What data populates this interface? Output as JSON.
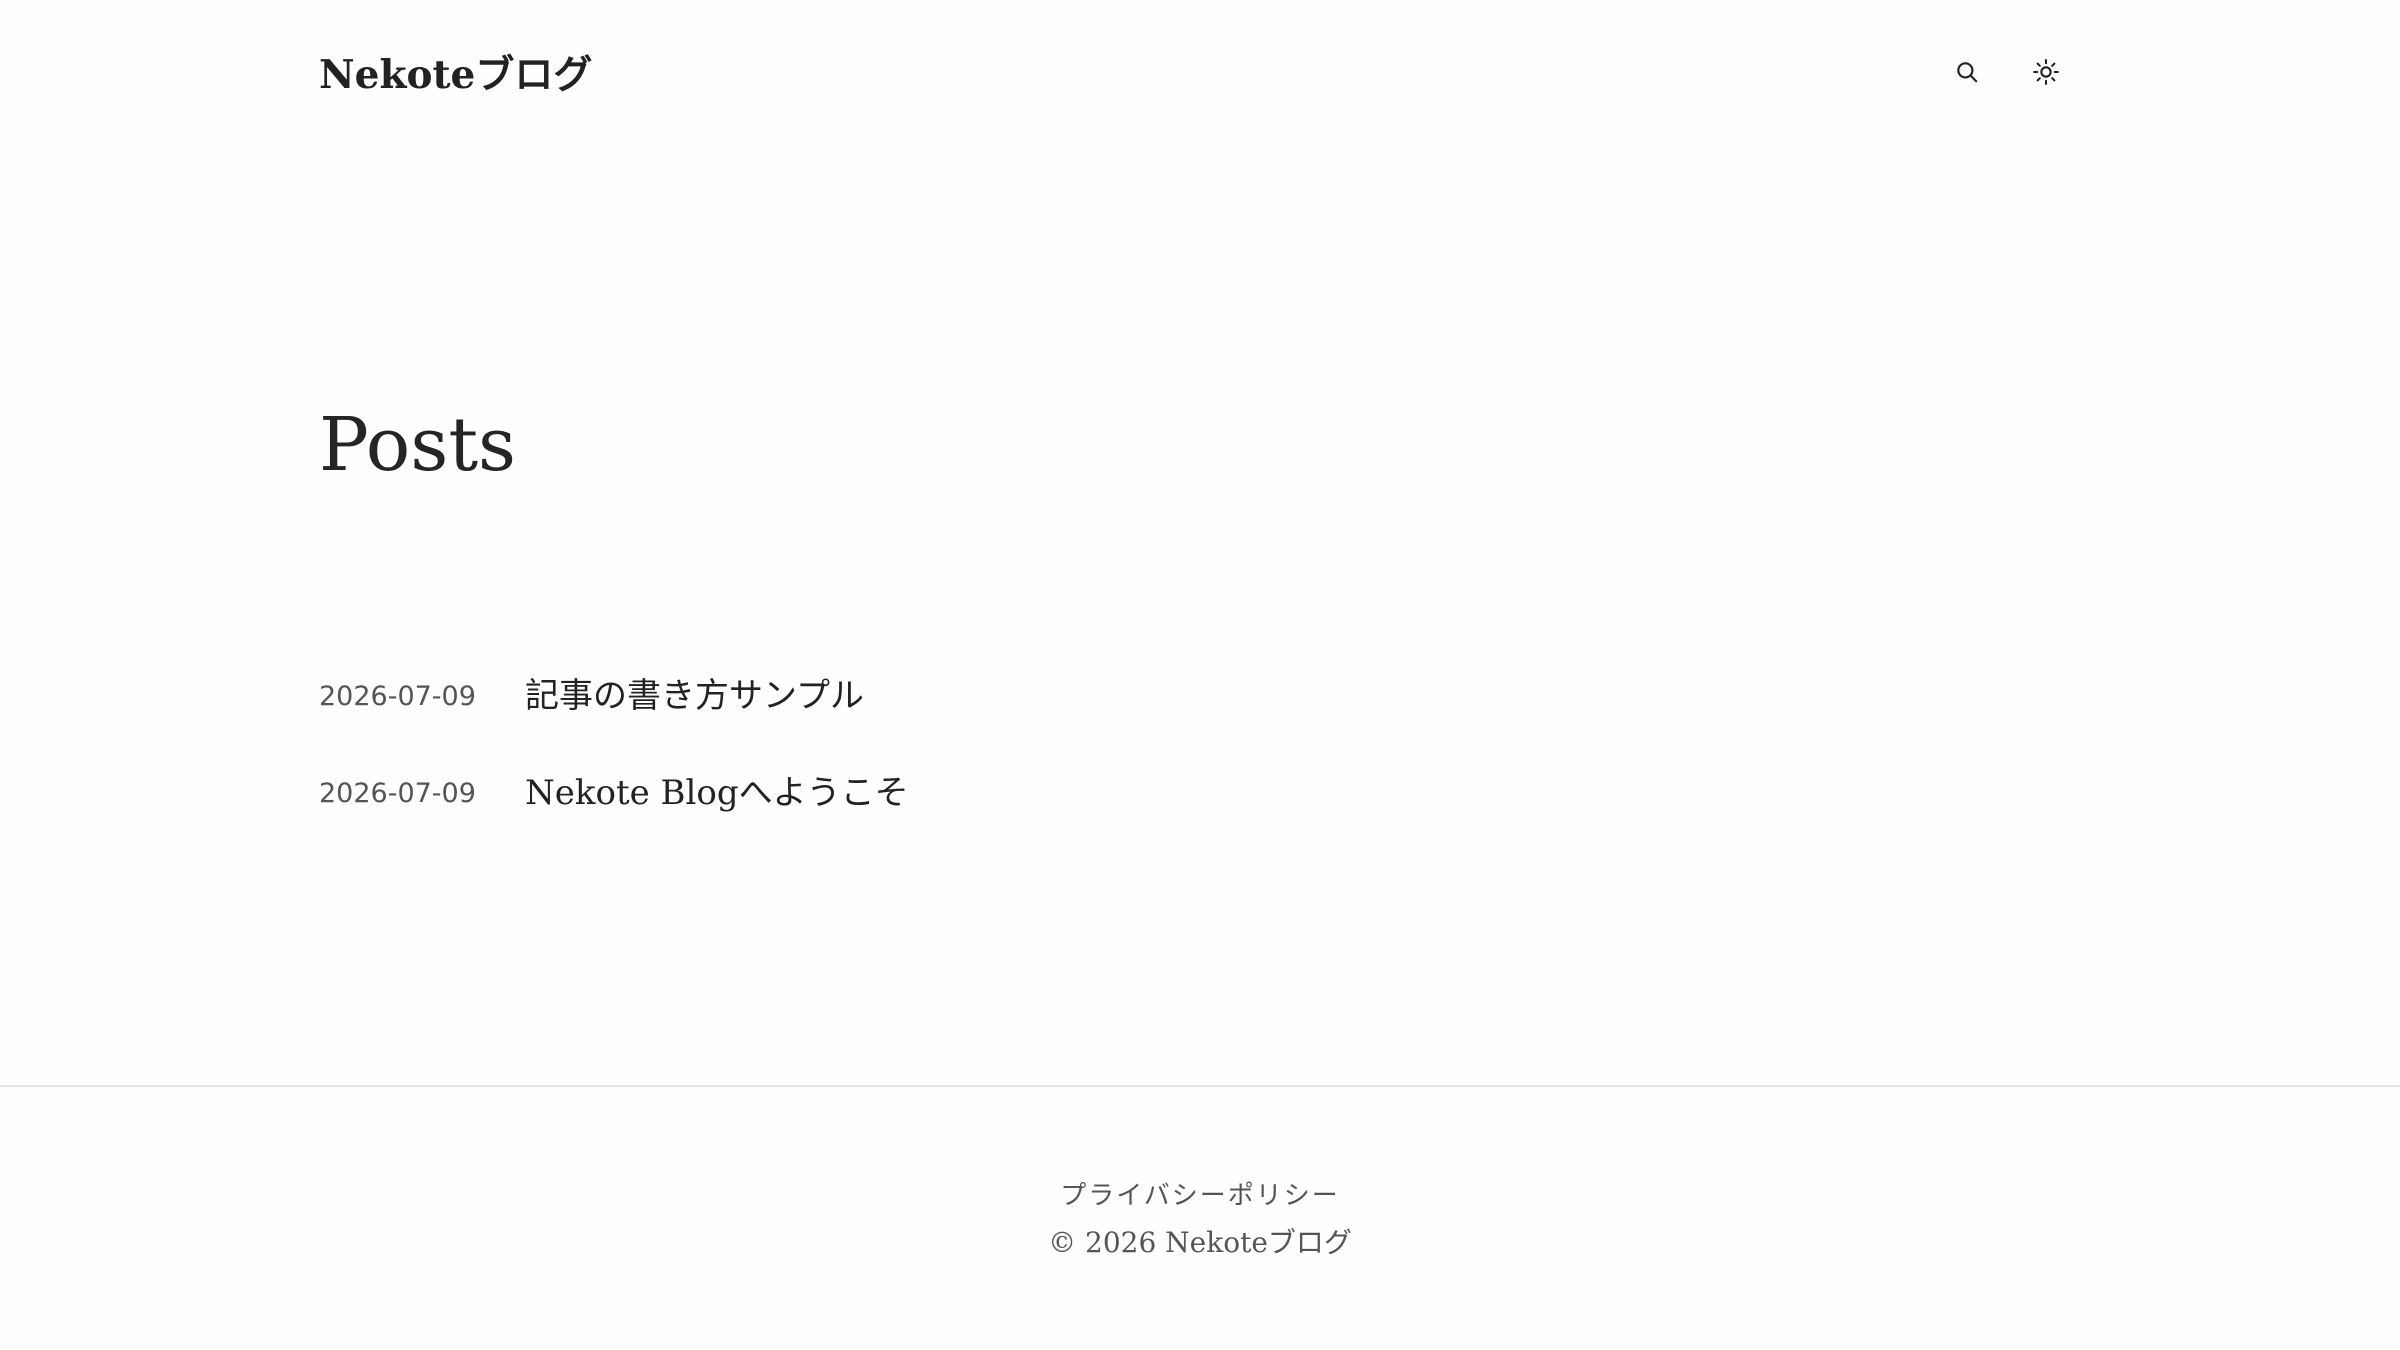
{
  "header": {
    "site_title": "Nekoteブログ",
    "search_icon": "search-icon",
    "theme_icon": "sun-icon"
  },
  "main": {
    "heading": "Posts",
    "posts": [
      {
        "date": "2026-07-09",
        "title": "記事の書き方サンプル"
      },
      {
        "date": "2026-07-09",
        "title": "Nekote Blogへようこそ"
      }
    ]
  },
  "footer": {
    "privacy_link": "プライバシーポリシー",
    "copyright": "© 2026 Nekoteブログ"
  },
  "colors": {
    "background": "#fffefe",
    "text": "#2b2b2b",
    "muted_text": "#555555",
    "divider": "#e7e7e7"
  }
}
